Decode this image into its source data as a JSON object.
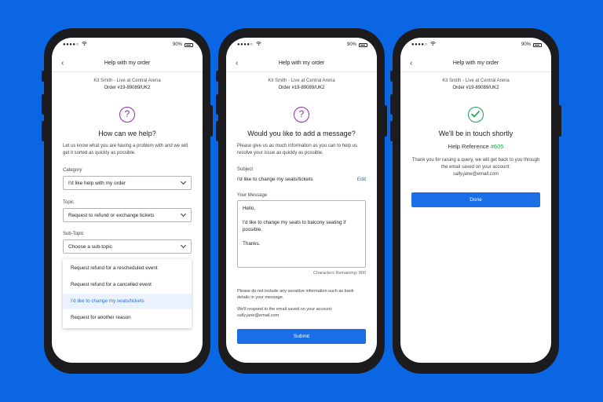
{
  "colors": {
    "background": "#0b66e4",
    "primary": "#1a6fe6",
    "question_icon": "#9c27b0",
    "success": "#1ba34a"
  },
  "status": {
    "signal": "●●●●○",
    "battery_pct": "90%"
  },
  "common": {
    "nav_title": "Help with my order",
    "event": "Kit Smith - Live at Central Arena",
    "order": "Order #19-89089/UK2"
  },
  "screen1": {
    "question_mark": "?",
    "heading": "How can we help?",
    "intro": "Let us know what you are having a problem with and we will get it sorted as quickly as possible.",
    "category_label": "Category",
    "category_value": "I'd like help with my order",
    "topic_label": "Topic",
    "topic_value": "Request to refund or exchange tickets",
    "subtopic_label": "Sub-Topic",
    "subtopic_placeholder": "Choose a sub-topic",
    "options": [
      "Request refund for a rescheduled event",
      "Request refund for a cancelled event",
      "I'd like to change my seats/tickets",
      "Request for another reason"
    ]
  },
  "screen2": {
    "question_mark": "?",
    "heading": "Would you like to add a message?",
    "intro": "Please give us as much information as you can to help us resolve your issue as quickly as possible.",
    "subject_label": "Subject",
    "subject_value": "I'd like to change my seats/tickets",
    "edit": "Edit",
    "message_label": "Your Message",
    "message_lines": [
      "Hello,",
      "",
      "I'd like to change my seats to balcony seating if possible.",
      "",
      "Thanks."
    ],
    "remaining": "Characters Remaining: 800",
    "note": "Please do not include any sensitive information such as bank details in your message.",
    "respond": "We'll respond to the email saved on your account:",
    "email": "sally.jane@email.com",
    "submit": "Submit"
  },
  "screen3": {
    "heading": "We'll be in touch shortly",
    "ref_label": "Help Reference",
    "ref_number": "#605",
    "message": "Thank you for raising a query, we will get back to you through the email saved on your account:",
    "email": "sally.jane@email.com",
    "done": "Done"
  }
}
